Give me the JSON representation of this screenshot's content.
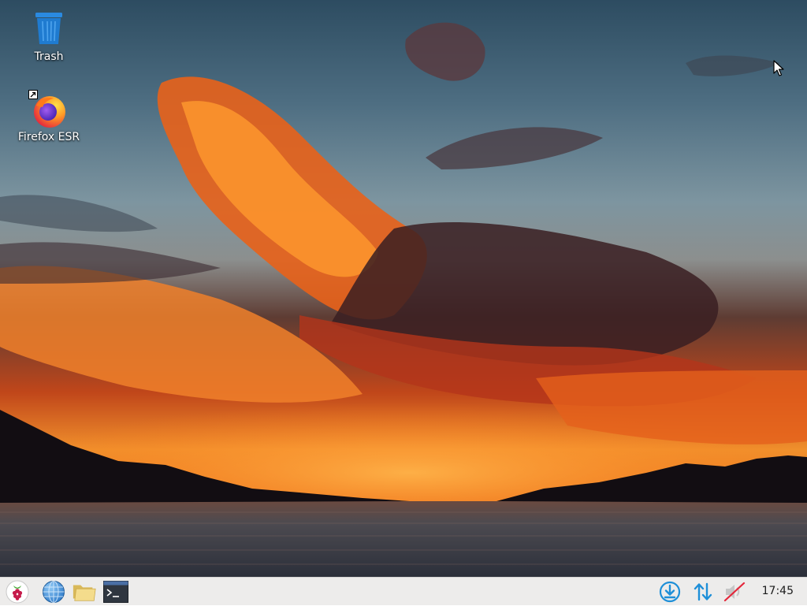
{
  "desktop": {
    "icons": [
      {
        "label": "Trash",
        "icon": "trash-icon"
      },
      {
        "label": "Firefox ESR",
        "icon": "firefox-icon"
      }
    ]
  },
  "taskbar": {
    "launchers": [
      {
        "icon": "raspberry-pi-menu-icon"
      },
      {
        "icon": "web-browser-globe-icon"
      },
      {
        "icon": "file-manager-folder-icon"
      },
      {
        "icon": "terminal-icon"
      }
    ],
    "tray": [
      {
        "icon": "updates-download-icon"
      },
      {
        "icon": "network-updown-arrows-icon"
      },
      {
        "icon": "volume-muted-icon"
      }
    ],
    "clock": "17:45"
  },
  "colors": {
    "taskbar_bg": "#edeceb",
    "tray_accent": "#1e8fd8",
    "trash_blue": "#1f7bd0"
  }
}
